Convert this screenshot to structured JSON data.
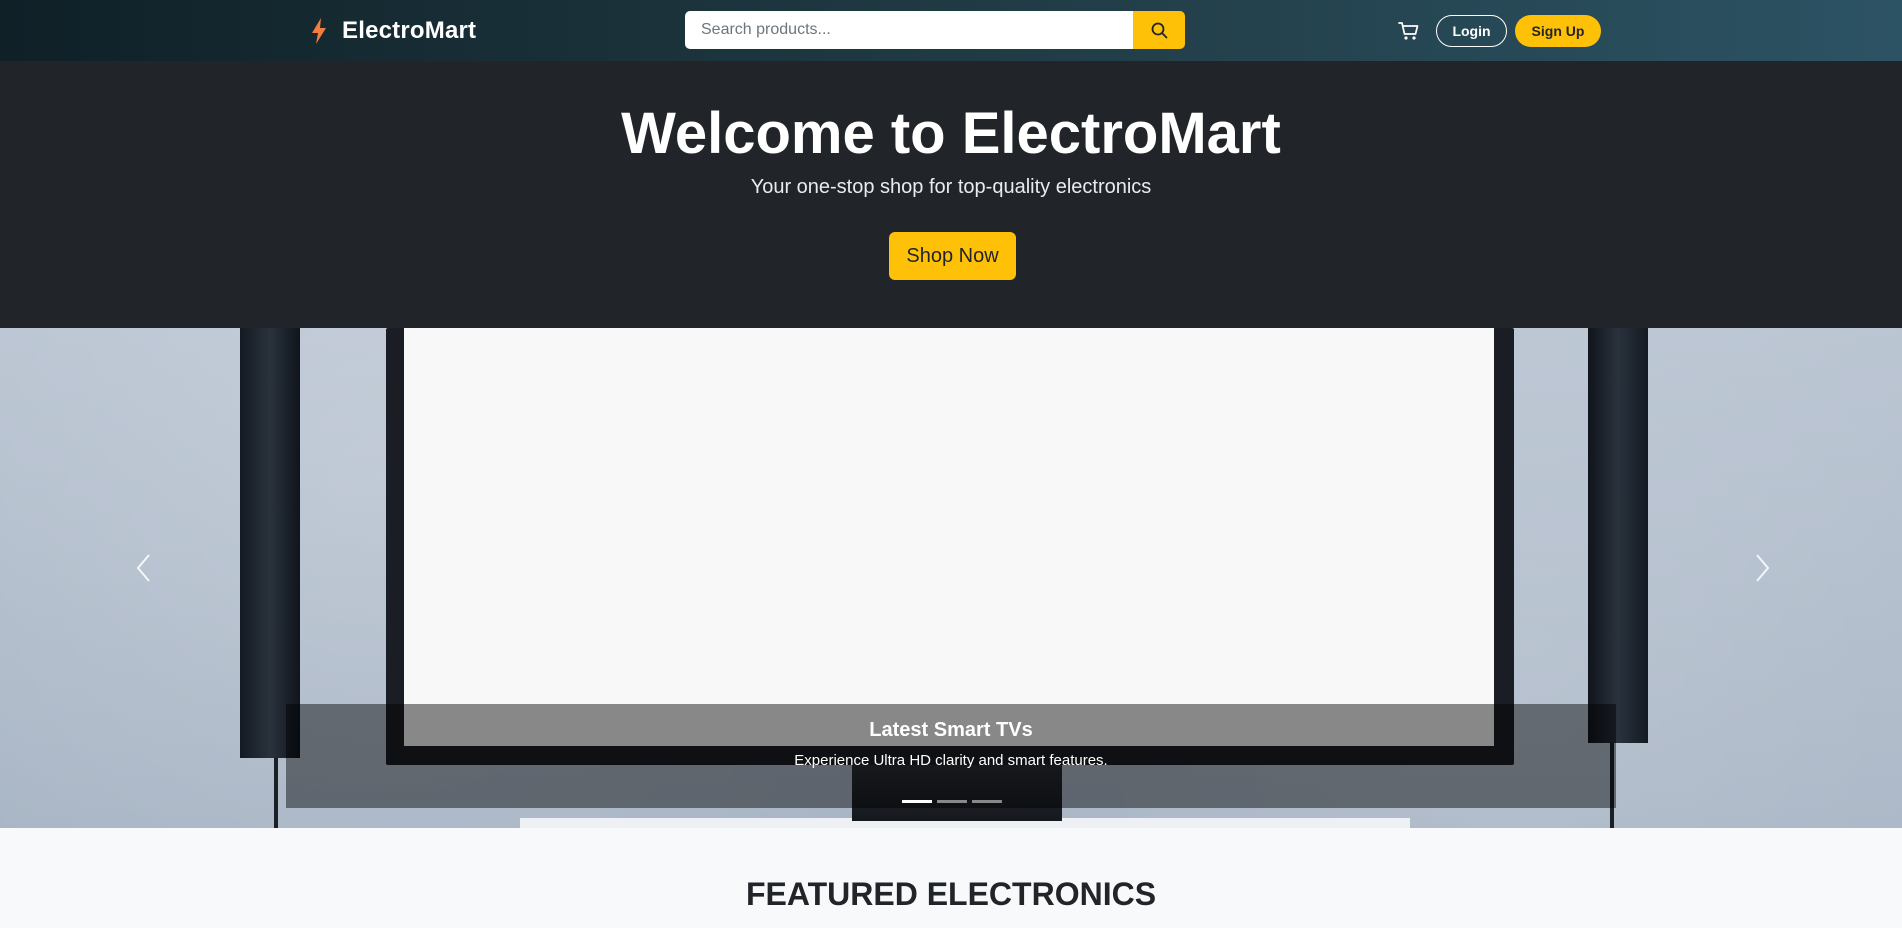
{
  "colors": {
    "accent": "#ffc107",
    "hero_bg": "#212529",
    "navbar_gradient": [
      "#0f2027",
      "#203a43",
      "#2c5364"
    ],
    "brand_icon": "#f47c3c"
  },
  "navbar": {
    "brand": {
      "icon": "lightning-bolt-icon",
      "name": "ElectroMart"
    },
    "search": {
      "placeholder": "Search products...",
      "value": "",
      "button_icon": "search-icon"
    },
    "cart_icon": "cart-icon",
    "login_label": "Login",
    "signup_label": "Sign Up"
  },
  "hero": {
    "title": "Welcome to ElectroMart",
    "subtitle": "Your one-stop shop for top-quality electronics",
    "cta_label": "Shop Now"
  },
  "carousel": {
    "active_index": 0,
    "slide_count": 3,
    "prev_icon": "chevron-left-icon",
    "next_icon": "chevron-right-icon",
    "active_slide": {
      "title": "Latest Smart TVs",
      "description": "Experience Ultra HD clarity and smart features."
    }
  },
  "featured": {
    "heading": "FEATURED ELECTRONICS"
  }
}
